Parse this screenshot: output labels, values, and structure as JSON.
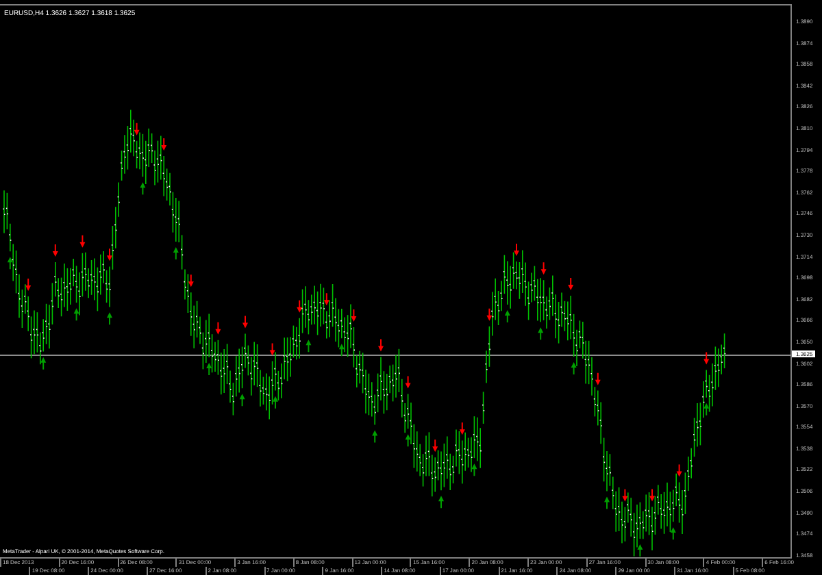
{
  "chart": {
    "title": "EURUSD,H4  1.3626 1.3627 1.3618 1.3625",
    "copyright": "MetaTrader - Alpari UK, © 2001-2014, MetaQuotes Software Corp.",
    "price_labels": [
      "1.3890",
      "1.3874",
      "1.3858",
      "1.3842",
      "1.3826",
      "1.3810",
      "1.3794",
      "1.3778",
      "1.3762",
      "1.3746",
      "1.3730",
      "1.3714",
      "1.3698",
      "1.3682",
      "1.3666",
      "1.3650",
      "1.3602",
      "1.3586",
      "1.3570",
      "1.3554",
      "1.3538",
      "1.3522",
      "1.3506",
      "1.3490",
      "1.3474",
      "1.3458"
    ],
    "current_price": "1.3625",
    "time_labels": [
      "18 Dec 2013",
      "19 Dec 08:00",
      "20 Dec 16:00",
      "24 Dec 00:00",
      "26 Dec 08:00",
      "27 Dec 16:00",
      "31 Dec 00:00",
      "2 Jan 08:00",
      "3 Jan 16:00",
      "7 Jan 00:00",
      "8 Jan 08:00",
      "9 Jan 16:00",
      "13 Jan 00:00",
      "14 Jan 08:00",
      "15 Jan 16:00",
      "17 Jan 00:00",
      "20 Jan 08:00",
      "21 Jan 16:00",
      "23 Jan 00:00",
      "24 Jan 08:00",
      "27 Jan 16:00",
      "29 Jan 00:00",
      "30 Jan 08:00",
      "31 Jan 16:00",
      "4 Feb 00:00",
      "5 Feb 08:00",
      "6 Feb 16:00"
    ]
  }
}
